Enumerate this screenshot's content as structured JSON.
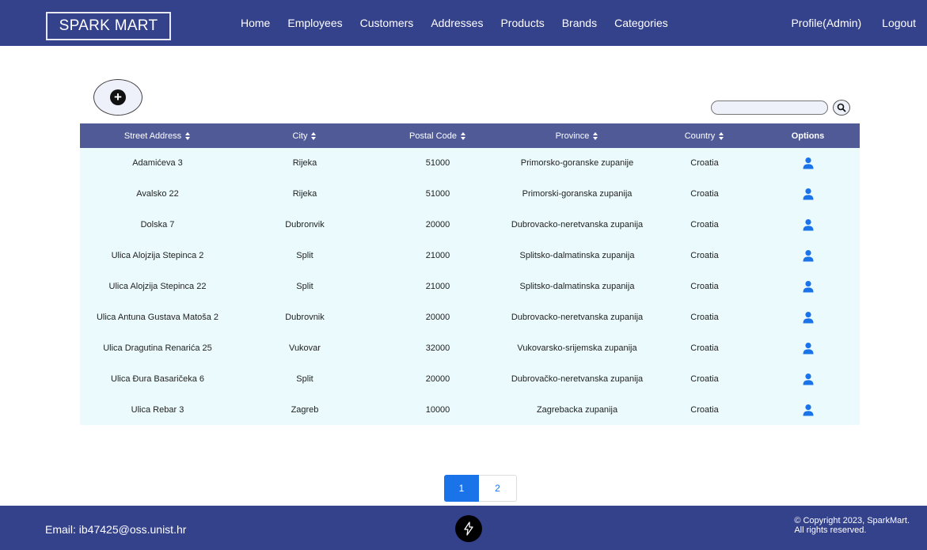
{
  "brand": "SPARK MART",
  "nav": {
    "items": [
      "Home",
      "Employees",
      "Customers",
      "Addresses",
      "Products",
      "Brands",
      "Categories"
    ],
    "profile": "Profile(Admin)",
    "logout": "Logout"
  },
  "search": {
    "placeholder": ""
  },
  "table": {
    "columns": [
      "Street Address",
      "City",
      "Postal Code",
      "Province",
      "Country",
      "Options"
    ],
    "rows": [
      [
        "Adamićeva 3",
        "Rijeka",
        "51000",
        "Primorsko-goranske zupanije",
        "Croatia"
      ],
      [
        "Avalsko 22",
        "Rijeka",
        "51000",
        "Primorski-goranska zupanija",
        "Croatia"
      ],
      [
        "Dolska 7",
        "Dubronvik",
        "20000",
        "Dubrovacko-neretvanska zupanija",
        "Croatia"
      ],
      [
        "Ulica Alojzija Stepinca 2",
        "Split",
        "21000",
        "Splitsko-dalmatinska zupanija",
        "Croatia"
      ],
      [
        "Ulica Alojzija Stepinca 22",
        "Split",
        "21000",
        "Splitsko-dalmatinska zupanija",
        "Croatia"
      ],
      [
        "Ulica Antuna Gustava Matoša 2",
        "Dubrovnik",
        "20000",
        "Dubrovacko-neretvanska zupanija",
        "Croatia"
      ],
      [
        "Ulica Dragutina Renarića 25",
        "Vukovar",
        "32000",
        "Vukovarsko-srijemska zupanija",
        "Croatia"
      ],
      [
        "Ulica Đura Basaričeka 6",
        "Split",
        "20000",
        "Dubrovačko-neretvanska zupanija",
        "Croatia"
      ],
      [
        "Ulica Rebar 3",
        "Zagreb",
        "10000",
        "Zagrebacka zupanija",
        "Croatia"
      ]
    ]
  },
  "pagination": {
    "pages": [
      "1",
      "2"
    ],
    "active": "1"
  },
  "footer": {
    "email": "Email: ib47425@oss.unist.hr",
    "copyright_line1": "© Copyright 2023, SparkMart.",
    "copyright_line2": "All rights reserved."
  },
  "colors": {
    "nav_bg": "#34418b",
    "header_bg": "#505a97",
    "row_bg": "#ebfbfd",
    "accent": "#1a73e8"
  },
  "icons": {
    "add": "plus-circle-icon",
    "search": "search-icon",
    "option": "user-icon",
    "sort": "sort-icon",
    "footer_logo": "lightning-logo-icon"
  }
}
